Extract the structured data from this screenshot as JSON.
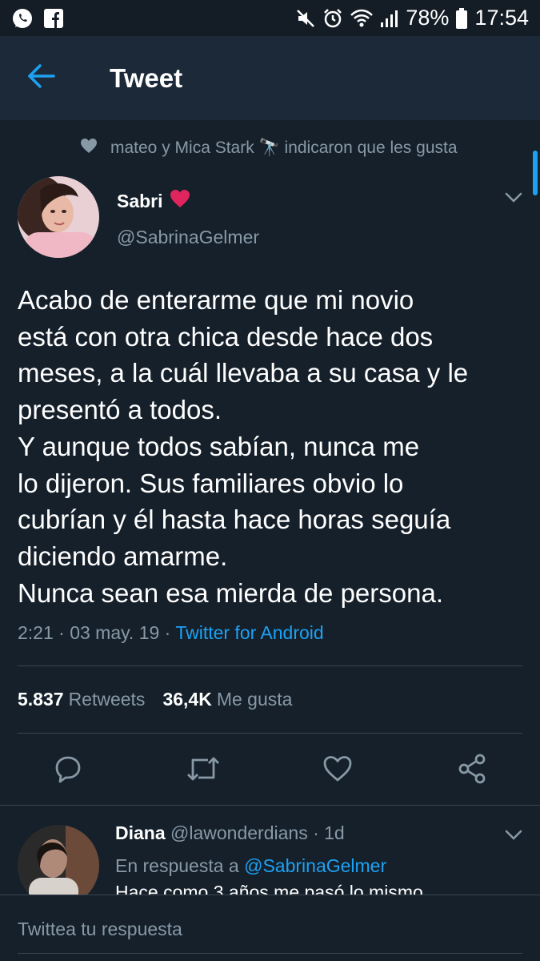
{
  "status_bar": {
    "battery": "78%",
    "time": "17:54",
    "left_icons": [
      "whatsapp-icon",
      "facebook-icon"
    ],
    "right_icons": [
      "mute-icon",
      "alarm-icon",
      "wifi-icon",
      "signal-icon",
      "battery-icon"
    ]
  },
  "header": {
    "title": "Tweet",
    "back_icon": "arrow-left-icon"
  },
  "liked_by": {
    "text": "mateo y Mica Stark 🔭 indicaron que les gusta",
    "icon": "heart-icon"
  },
  "tweet": {
    "author_name": "Sabri",
    "author_emoji": "❤️",
    "author_handle": "@SabrinaGelmer",
    "text_lines": [
      "Acabo de enterarme que mi novio",
      "está con otra chica desde hace dos",
      "meses, a la cuál llevaba a su casa y le",
      "presentó a todos.",
      "Y aunque todos sabían, nunca me",
      "lo dijeron. Sus familiares obvio lo",
      "cubrían y él hasta hace horas seguía",
      "diciendo amarme.",
      "Nunca sean esa mierda de persona."
    ],
    "time": "2:21 · 03 may. 19 · ",
    "source": "Twitter for Android",
    "retweets_count": "5.837",
    "retweets_label": "Retweets",
    "likes_count": "36,4K",
    "likes_label": "Me gusta"
  },
  "actions": [
    "reply-icon",
    "retweet-icon",
    "like-icon",
    "share-icon"
  ],
  "reply": {
    "name": "Diana",
    "meta": " @lawonderdians · 1d",
    "in_reply_prefix": "En respuesta a ",
    "in_reply_mention": "@SabrinaGelmer",
    "text": "Hace como 3 años me pasó lo mismo"
  },
  "composer": {
    "placeholder": "Twittea tu respuesta"
  },
  "colors": {
    "background": "#15202b",
    "header": "#1c2938",
    "accent": "#1da1f2",
    "muted": "#8899a6",
    "heart": "#e0245e"
  }
}
